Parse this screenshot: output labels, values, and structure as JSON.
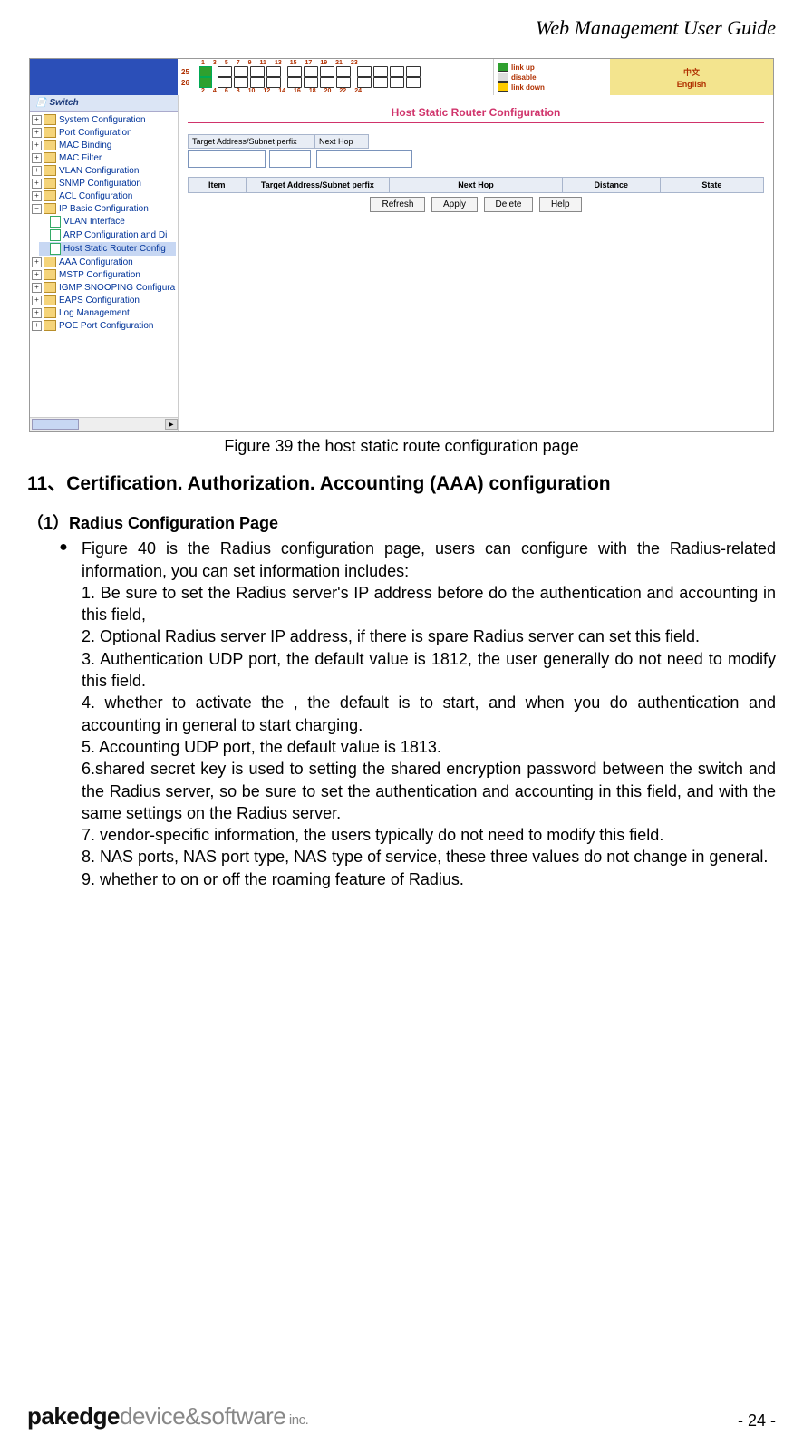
{
  "doc_header": "Web Management User Guide",
  "screenshot": {
    "ports": {
      "row1_label": "25",
      "row1_numbers": [
        "1",
        "3",
        "5",
        "7",
        "9",
        "11",
        "13",
        "15",
        "17",
        "19",
        "21",
        "23"
      ],
      "row2_label": "26",
      "row2_numbers": [
        "2",
        "4",
        "6",
        "8",
        "10",
        "12",
        "14",
        "16",
        "18",
        "20",
        "22",
        "24"
      ]
    },
    "legend": {
      "link_up": "link up",
      "disable": "disable",
      "link_down": "link down"
    },
    "lang": {
      "cn": "中文",
      "en": "English"
    },
    "sidebar_title": "Switch",
    "tree": {
      "system": "System Configuration",
      "port": "Port Configuration",
      "mac_binding": "MAC Binding",
      "mac_filter": "MAC Filter",
      "vlan": "VLAN Configuration",
      "snmp": "SNMP Configuration",
      "acl": "ACL Configuration",
      "ip_basic": "IP Basic Configuration",
      "vlan_interface": "VLAN Interface",
      "arp_config": "ARP Configuration and Di",
      "host_static": "Host Static Router Config",
      "aaa": "AAA Configuration",
      "mstp": "MSTP Configuration",
      "igmp": "IGMP SNOOPING Configura",
      "eaps": "EAPS Configuration",
      "log": "Log Management",
      "poe": "POE Port Configuration"
    },
    "main": {
      "title": "Host Static Router Configuration",
      "form_label1": "Target Address/Subnet perfix",
      "form_label2": "Next Hop",
      "table_headers": {
        "item": "Item",
        "target": "Target Address/Subnet perfix",
        "next_hop": "Next Hop",
        "distance": "Distance",
        "state": "State"
      },
      "buttons": {
        "refresh": "Refresh",
        "apply": "Apply",
        "delete": "Delete",
        "help": "Help"
      }
    }
  },
  "caption": "Figure 39 the host static route configuration page",
  "section_heading": "11、Certification. Authorization. Accounting (AAA) configuration",
  "sub_heading": "（1）Radius Configuration Page",
  "bullet_intro": "Figure 40 is the Radius configuration page, users can configure with the Radius-related information, you can set information includes:",
  "bullets": {
    "p1": "1. Be sure to set the Radius server's IP address before do the authentication and accounting in this field,",
    "p2": "2. Optional Radius server IP  address, if there is spare Radius server can set this field.",
    "p3": "3. Authentication UDP port, the  default value is 1812, the user generally do not need to modify this field.",
    "p4": "4. whether to activate the , the default is to start, and when you do authentication and accounting in general to start charging.",
    "p5": "5. Accounting UDP port, the default value is 1813.",
    "p6": "6.shared secret key is used to setting the shared encryption password between the switch and the Radius server, so be sure to set the authentication and accounting in this field, and with the same settings on the Radius server.",
    "p7": "7. vendor-specific information,  the users typically do not need to modify this field.",
    "p8": "8. NAS ports, NAS port type, NAS  type of service, these three values do not change in general.",
    "p9": "9. whether to on or off the roaming feature of Radius."
  },
  "footer": {
    "logo_bold": "pakedge",
    "logo_light": "device&software",
    "logo_inc": " inc.",
    "page_num": "- 24 -"
  }
}
